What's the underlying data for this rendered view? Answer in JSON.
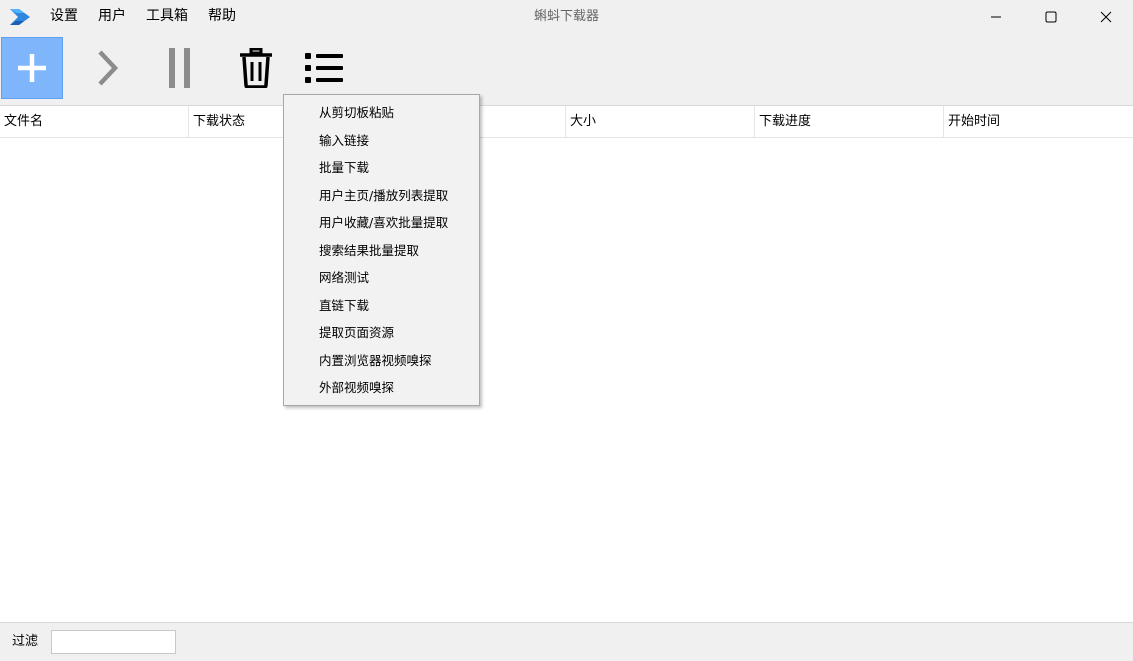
{
  "window": {
    "title": "蝌蚪下载器"
  },
  "menubar": {
    "items": [
      {
        "label": "设置"
      },
      {
        "label": "用户"
      },
      {
        "label": "工具箱"
      },
      {
        "label": "帮助"
      }
    ]
  },
  "toolbar": {
    "buttons": [
      {
        "icon": "plus-icon",
        "state": "active"
      },
      {
        "icon": "play-icon",
        "state": "disabled"
      },
      {
        "icon": "pause-icon",
        "state": "disabled"
      },
      {
        "icon": "trash-icon",
        "state": "enabled"
      },
      {
        "icon": "list-icon",
        "state": "enabled"
      }
    ]
  },
  "table": {
    "columns": [
      "文件名",
      "下载状态",
      "",
      "大小",
      "下载进度",
      "开始时间"
    ],
    "rows": []
  },
  "context_menu": {
    "items": [
      {
        "label": "从剪切板粘贴"
      },
      {
        "label": "输入链接"
      },
      {
        "label": "批量下载"
      },
      {
        "label": "用户主页/播放列表提取"
      },
      {
        "label": "用户收藏/喜欢批量提取"
      },
      {
        "label": "搜索结果批量提取"
      },
      {
        "label": "网络测试"
      },
      {
        "label": "直链下载"
      },
      {
        "label": "提取页面资源"
      },
      {
        "label": "内置浏览器视频嗅探"
      },
      {
        "label": "外部视频嗅探"
      }
    ]
  },
  "statusbar": {
    "filter_label": "过滤",
    "filter_value": ""
  },
  "colors": {
    "accent": "#7fb5fb",
    "window_bg": "#f0f0f0",
    "table_bg": "#ffffff",
    "disabled_icon": "#8c8c8c"
  }
}
